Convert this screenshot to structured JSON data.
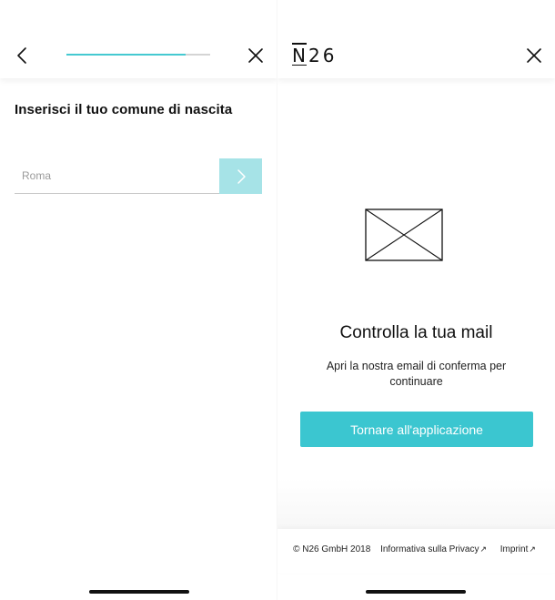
{
  "left_screen": {
    "progress_value": 0.83,
    "title": "Inserisci il tuo comune di nascita",
    "birthplace_input": {
      "value": "",
      "placeholder": "Roma"
    },
    "colors": {
      "progress_fill": "#45c9d1",
      "progress_track": "#d4d4d4",
      "next_button_bg": "#a6e3e7"
    },
    "icons": {
      "back": "chevron-left-icon",
      "close": "close-icon",
      "next": "chevron-right-icon"
    }
  },
  "right_screen": {
    "logo": {
      "n": "N",
      "rest": "26"
    },
    "illustration": "envelope-icon",
    "title": "Controlla la tua mail",
    "body": "Apri la nostra email di conferma per continuare",
    "cta_label": "Tornare all'applicazione",
    "footer": {
      "copyright": "© N26 GmbH 2018",
      "privacy_label": "Informativa sulla Privacy",
      "imprint_label": "Imprint",
      "external_link_glyph": "↗"
    },
    "colors": {
      "cta_bg": "#3bc6d0",
      "cta_text": "#ffffff"
    }
  }
}
